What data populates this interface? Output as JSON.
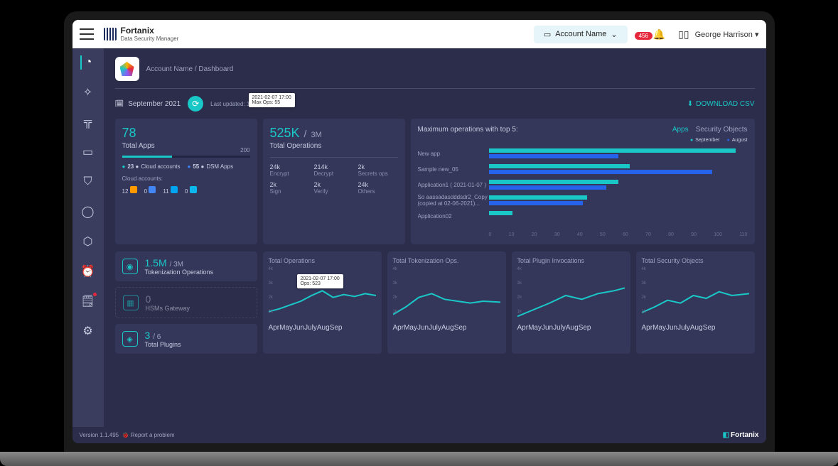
{
  "header": {
    "brand_name": "Fortanix",
    "brand_sub": "Data Security Manager",
    "account_dropdown": "Account Name",
    "notification_count": "456",
    "user_name": "George Harrison"
  },
  "breadcrumb": "Account Name / Dashboard",
  "filter": {
    "month": "September 2021",
    "last_updated": "Last updated: 1 month ago",
    "download_csv": "DOWNLOAD CSV"
  },
  "apps_card": {
    "value": "78",
    "label": "Total Apps",
    "max": "200",
    "legend": [
      {
        "count": "23",
        "name": "Cloud accounts"
      },
      {
        "count": "55",
        "name": "DSM Apps"
      }
    ],
    "cloud_label": "Cloud accounts:",
    "clouds": [
      {
        "n": "12",
        "color": "#ff9900"
      },
      {
        "n": "0",
        "color": "#4285f4"
      },
      {
        "n": "11",
        "color": "#00a4ef"
      },
      {
        "n": "0",
        "color": "#0db7ed"
      }
    ]
  },
  "ops_card": {
    "value": "525K",
    "sub": "3M",
    "label": "Total Operations",
    "breakdown": [
      {
        "v": "24k",
        "n": "Encrypt"
      },
      {
        "v": "214k",
        "n": "Decrypt"
      },
      {
        "v": "2k",
        "n": "Secrets ops"
      },
      {
        "v": "2k",
        "n": "Sign"
      },
      {
        "v": "2k",
        "n": "Verify"
      },
      {
        "v": "24k",
        "n": "Others"
      }
    ]
  },
  "max_ops": {
    "title": "Maximum operations with top 5:",
    "tabs": [
      "Apps",
      "Security Objects"
    ],
    "active_tab": "Apps",
    "legend": [
      "September",
      "August"
    ],
    "tooltip_date": "2021-02-07 17:00",
    "tooltip_val": "Max Ops: 55",
    "x_ticks": [
      "0",
      "10",
      "20",
      "30",
      "40",
      "50",
      "60",
      "70",
      "80",
      "90",
      "100",
      "110"
    ]
  },
  "tokenization": {
    "value": "1.5M",
    "sub": "3M",
    "label": "Tokenization Operations"
  },
  "hsm": {
    "value": "0",
    "label": "HSMs Gateway"
  },
  "plugins": {
    "value": "3",
    "sub": "6",
    "label": "Total Plugins"
  },
  "line_charts": [
    {
      "title": "Total Operations",
      "tooltip_date": "2021-02-07 17:00",
      "tooltip_val": "Ops: 523"
    },
    {
      "title": "Total Tokenization Ops."
    },
    {
      "title": "Total Plugin Invocations"
    },
    {
      "title": "Total Security Objects"
    }
  ],
  "line_y_ticks": [
    "4k",
    "3k",
    "2k",
    "1k"
  ],
  "line_x_ticks": [
    "Apr",
    "May",
    "Jun",
    "July",
    "Aug",
    "Sep"
  ],
  "footer": {
    "version": "Version 1.1.495",
    "report": "Report a problem",
    "brand": "Fortanix"
  },
  "chart_data": {
    "max_operations_bar": {
      "type": "bar",
      "categories": [
        "New app",
        "Sample new_05",
        "Application1 ( 2021-01-07 )",
        "So aassadasdddsdr2_Copy (copied at 02-06-2021)...",
        "Application02"
      ],
      "series": [
        {
          "name": "September",
          "values": [
            105,
            60,
            55,
            42,
            10
          ]
        },
        {
          "name": "August",
          "values": [
            55,
            95,
            50,
            40,
            0
          ]
        }
      ],
      "xlim": [
        0,
        110
      ],
      "x_ticks": [
        0,
        10,
        20,
        30,
        40,
        50,
        60,
        70,
        80,
        90,
        100,
        110
      ]
    },
    "line_charts": [
      {
        "title": "Total Operations",
        "type": "line",
        "x": [
          "Apr",
          "May",
          "Jun",
          "July",
          "Aug",
          "Sep"
        ],
        "y": [
          900,
          1200,
          1800,
          2300,
          1900,
          2100
        ],
        "ylim": [
          0,
          4000
        ]
      },
      {
        "title": "Total Tokenization Ops.",
        "type": "line",
        "x": [
          "Apr",
          "May",
          "Jun",
          "July",
          "Aug",
          "Sep"
        ],
        "y": [
          700,
          1500,
          2200,
          2000,
          1700,
          1800
        ],
        "ylim": [
          0,
          4000
        ]
      },
      {
        "title": "Total Plugin Invocations",
        "type": "line",
        "x": [
          "Apr",
          "May",
          "Jun",
          "July",
          "Aug",
          "Sep"
        ],
        "y": [
          600,
          1100,
          1600,
          2100,
          1800,
          2300
        ],
        "ylim": [
          0,
          4000
        ]
      },
      {
        "title": "Total Security Objects",
        "type": "line",
        "x": [
          "Apr",
          "May",
          "Jun",
          "July",
          "Aug",
          "Sep"
        ],
        "y": [
          800,
          1300,
          1900,
          1700,
          2200,
          2000
        ],
        "ylim": [
          0,
          4000
        ]
      }
    ]
  }
}
